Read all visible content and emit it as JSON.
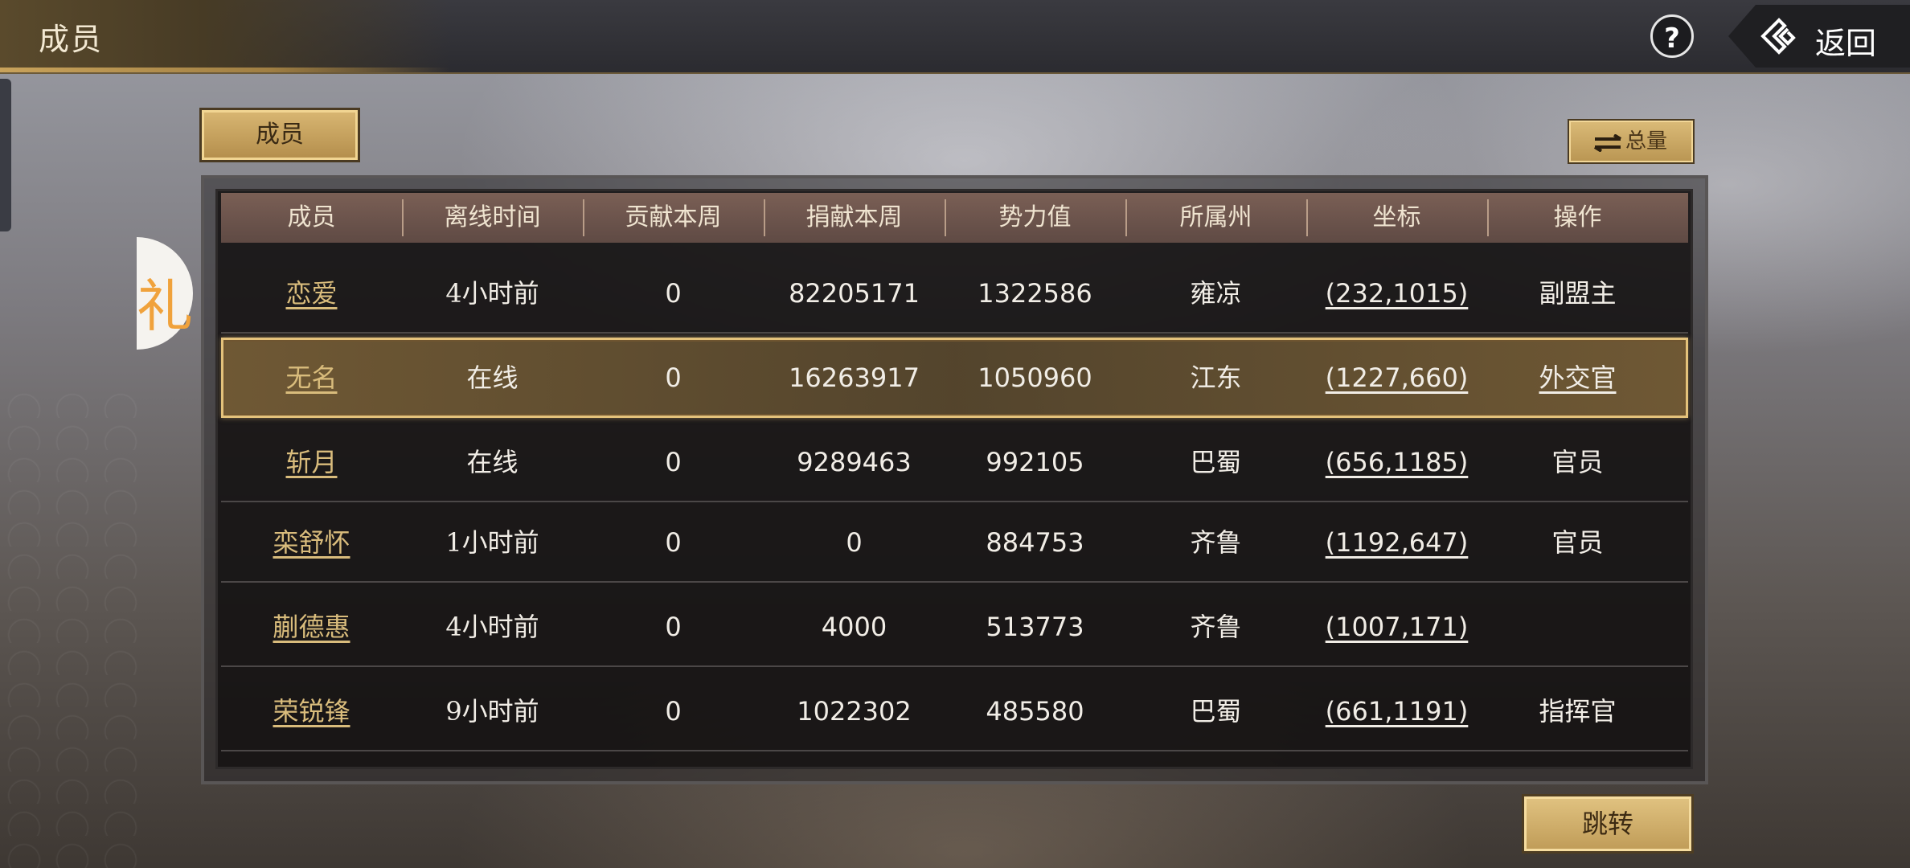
{
  "header": {
    "title": "成员",
    "help_symbol": "?",
    "back_label": "返回"
  },
  "side_badge": {
    "glyph": "礼"
  },
  "tabs": {
    "members_label": "成员"
  },
  "toolbar": {
    "total_label": "总量"
  },
  "table": {
    "columns": [
      "成员",
      "离线时间",
      "贡献本周",
      "捐献本周",
      "势力值",
      "所属州",
      "坐标",
      "操作"
    ],
    "rows": [
      {
        "name": "恋爱",
        "offline": "4小时前",
        "contribution": "0",
        "donation": "82205171",
        "power": "1322586",
        "state": "雍凉",
        "coords": "(232,1015)",
        "role": "副盟主"
      },
      {
        "name": "无名",
        "offline": "在线",
        "contribution": "0",
        "donation": "16263917",
        "power": "1050960",
        "state": "江东",
        "coords": "(1227,660)",
        "role": "外交官"
      },
      {
        "name": "斩月",
        "offline": "在线",
        "contribution": "0",
        "donation": "9289463",
        "power": "992105",
        "state": "巴蜀",
        "coords": "(656,1185)",
        "role": "官员"
      },
      {
        "name": "栾舒怀",
        "offline": "1小时前",
        "contribution": "0",
        "donation": "0",
        "power": "884753",
        "state": "齐鲁",
        "coords": "(1192,647)",
        "role": "官员"
      },
      {
        "name": "蒯德惠",
        "offline": "4小时前",
        "contribution": "0",
        "donation": "4000",
        "power": "513773",
        "state": "齐鲁",
        "coords": "(1007,171)",
        "role": ""
      },
      {
        "name": "荣锐锋",
        "offline": "9小时前",
        "contribution": "0",
        "donation": "1022302",
        "power": "485580",
        "state": "巴蜀",
        "coords": "(661,1191)",
        "role": "指挥官"
      }
    ],
    "selected_row_index": 1
  },
  "footer": {
    "jump_label": "跳转"
  },
  "colors": {
    "accent_gold": "#d9bc7c",
    "button_gold": "#d9b773",
    "header_row": "#6b534b",
    "selected_border": "#e4c27b"
  }
}
